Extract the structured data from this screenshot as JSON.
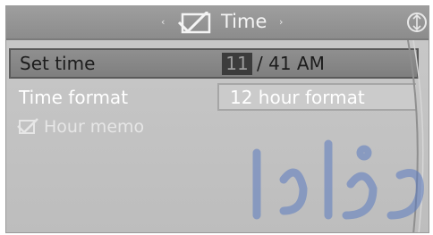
{
  "header": {
    "title": "Time",
    "icon": "checkbox-clock-icon",
    "left_arrow": "‹",
    "right_arrow": "›",
    "options_icon": "options-icon"
  },
  "menu": {
    "set_time": {
      "label": "Set time",
      "hour": "11",
      "rest": "/ 41 AM"
    },
    "time_format": {
      "label": "Time format",
      "value": "12 hour format"
    },
    "hour_memo": {
      "label": "Hour memo",
      "icon": "checkmark-icon",
      "enabled": false
    }
  },
  "colors": {
    "background": "#c4c4c4",
    "header": "#969696",
    "highlight": "#858585",
    "hour_box": "#3c3c3c"
  }
}
